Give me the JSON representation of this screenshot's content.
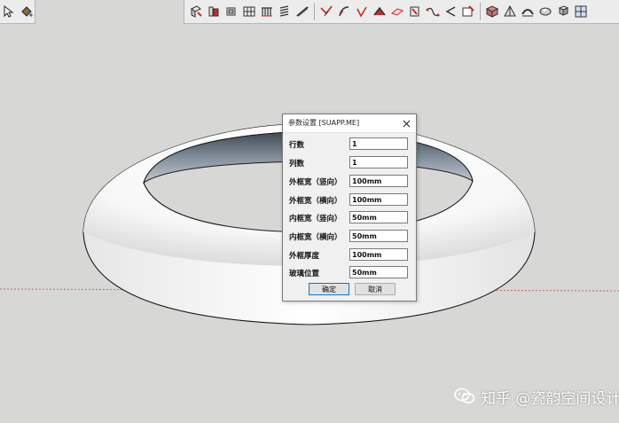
{
  "dialog": {
    "title": "参数设置 [SUAPP.ME]",
    "rows": [
      {
        "label": "行数",
        "value": "1"
      },
      {
        "label": "列数",
        "value": "1"
      },
      {
        "label": "外框宽（竖向）",
        "value": "100mm"
      },
      {
        "label": "外框宽（横向）",
        "value": "100mm"
      },
      {
        "label": "内框宽（竖向）",
        "value": "50mm"
      },
      {
        "label": "内框宽（横向）",
        "value": "50mm"
      },
      {
        "label": "外框厚度",
        "value": "100mm"
      },
      {
        "label": "玻璃位置",
        "value": "50mm"
      }
    ],
    "ok_label": "确定",
    "cancel_label": "取消"
  },
  "watermark": {
    "text": "知乎 @瓷韵空间设计"
  },
  "colors": {
    "viewport_bg": "#d7d7d5",
    "toolbar_bg": "#ececec",
    "accent_red": "#cc2a2a",
    "axis_red": "#c04a4a"
  }
}
